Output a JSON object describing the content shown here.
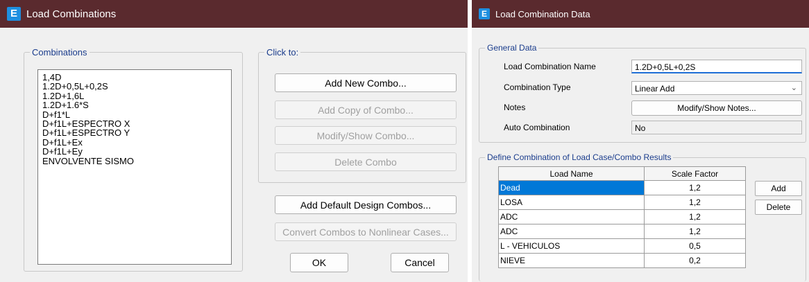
{
  "left_window": {
    "title": "Load Combinations",
    "combinations_group_label": "Combinations",
    "combinations": [
      "1,4D",
      "1.2D+0,5L+0,2S",
      "1.2D+1,6L",
      "1.2D+1.6*S",
      "D+f1*L",
      "D+f1L+ESPECTRO X",
      "D+f1L+ESPECTRO Y",
      "D+f1L+Ex",
      "D+f1L+Ey",
      "ENVOLVENTE SISMO"
    ],
    "click_to_group_label": "Click to:",
    "add_new_combo": "Add New Combo...",
    "add_copy_combo": "Add Copy of Combo...",
    "modify_show_combo": "Modify/Show Combo...",
    "delete_combo": "Delete Combo",
    "add_default_design": "Add Default Design Combos...",
    "convert_combos": "Convert Combos to Nonlinear Cases...",
    "ok": "OK",
    "cancel": "Cancel"
  },
  "right_window": {
    "title": "Load Combination Data",
    "general_data_label": "General Data",
    "name_label": "Load Combination Name",
    "name_value": "1.2D+0,5L+0,2S",
    "type_label": "Combination Type",
    "type_value": "Linear Add",
    "notes_label": "Notes",
    "notes_button": "Modify/Show Notes...",
    "auto_label": "Auto Combination",
    "auto_value": "No",
    "define_label": "Define Combination of Load Case/Combo Results",
    "col_load_name": "Load Name",
    "col_scale_factor": "Scale Factor",
    "rows": [
      {
        "name": "Dead",
        "factor": "1,2"
      },
      {
        "name": "LOSA",
        "factor": "1,2"
      },
      {
        "name": "ADC",
        "factor": "1,2"
      },
      {
        "name": "ADC",
        "factor": "1,2"
      },
      {
        "name": "L - VEHICULOS",
        "factor": "0,5"
      },
      {
        "name": "NIEVE",
        "factor": "0,2"
      }
    ],
    "add_button": "Add",
    "delete_button": "Delete"
  },
  "colors": {
    "titlebar": "#5a2a2e",
    "app_icon": "#1e8fe0",
    "selection": "#0078d7",
    "group_label": "#1a3c8c"
  }
}
